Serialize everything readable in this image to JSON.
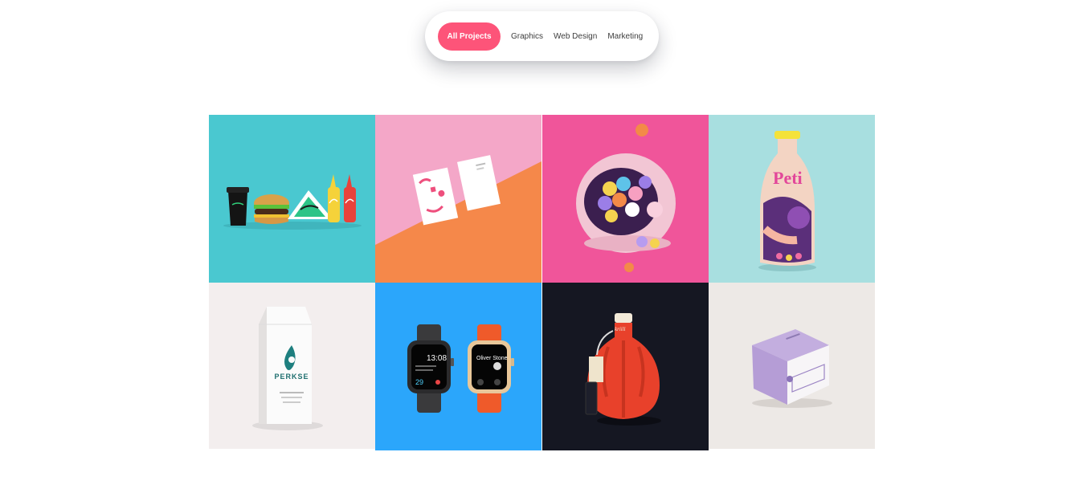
{
  "filters": {
    "items": [
      "All Projects",
      "Graphics",
      "Web Design",
      "Marketing"
    ],
    "active": "All Projects"
  },
  "colors": {
    "accent": "#fd5479"
  },
  "portfolio": {
    "tiles": [
      {
        "subject": "burger-branding-mockup",
        "bg": "#4ac8d0"
      },
      {
        "subject": "business-cards-mockup",
        "bg": "#f4a7c8"
      },
      {
        "subject": "astronaut-helmet-gumballs",
        "bg": "#f0559a"
      },
      {
        "subject": "juice-bottle-packaging",
        "bg": "#a8dfe0"
      },
      {
        "subject": "milk-carton-packaging",
        "bg": "#f3eeee"
      },
      {
        "subject": "smartwatch-mockup",
        "bg": "#2ba6fb"
      },
      {
        "subject": "red-bottle-packaging",
        "bg": "#151722"
      },
      {
        "subject": "lavender-box-packaging",
        "bg": "#ede9e6"
      }
    ],
    "tile_texts": {
      "bottle_brand": "Peti",
      "carton_brand": "PERKSE",
      "watch_time": "13:08",
      "watch_temp": "29",
      "watch_name": "Oliver Stone",
      "red_bottle_label": "kriili"
    }
  }
}
